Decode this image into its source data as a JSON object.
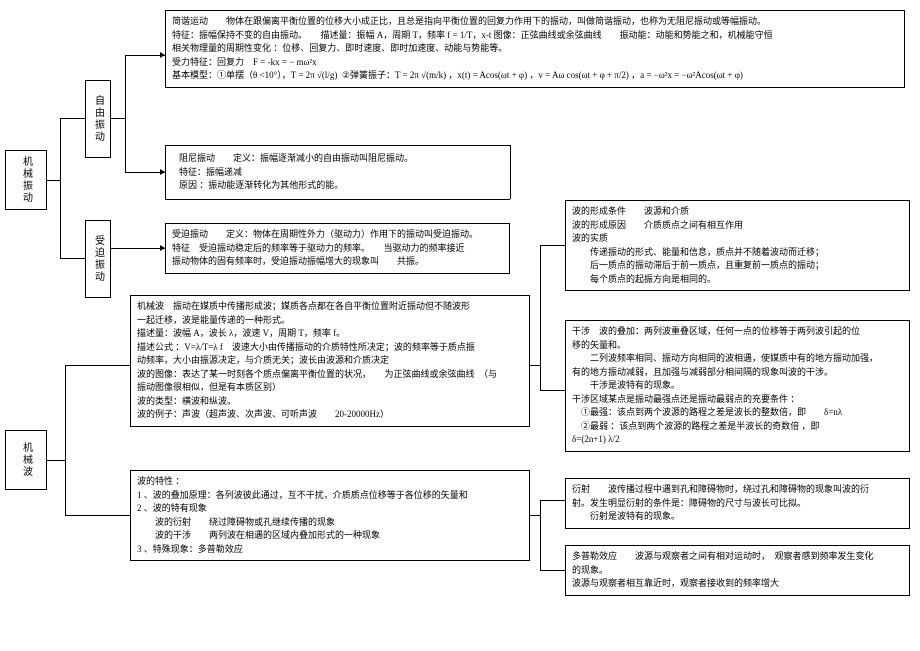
{
  "root1": "机械振动",
  "root2": "机械波",
  "sub1": "自由振动",
  "sub2": "受迫振动",
  "box_shm_title": "简谐运动",
  "box_shm_l1": "简谐运动　　物体在跟偏离平衡位置的位移大小成正比，且总是指向平衡位置的回复力作用下的振动，叫做简谐振动，也称为无阻尼振动或等幅振动。",
  "box_shm_l2": "特征：振幅保持不变的自由振动。　　描述量：振幅 A，周期 T，频率 f = 1/T，x-t 图像：正弦曲线或余弦曲线　　振动能：动能和势能之和，机械能守恒",
  "box_shm_l3": "相关物理量的周期性变化 ：位移、回复力、即时速度、即时加速度、动能与势能等。",
  "box_shm_l4": "受力特征：回复力　F = -kx = − mω²x",
  "box_shm_l5_a": "基本模型：①单摆（θ <10°），T = 2π",
  "box_shm_l5_b": "②弹簧振子：T = 2π",
  "box_shm_l5_c": "，x(t) = Acos(ωt + φ) ，v = Aω cos(ωt + φ + π/2) ，a = −ω²x = −ω²Acos(ωt + φ)",
  "box_damped_l1": "阻尼振动　　定义：振幅逐渐减小的自由振动叫阻尼振动。",
  "box_damped_l2": "特征：振幅递减",
  "box_damped_l3": "原因 ：振动能逐渐转化为其他形式的能。",
  "box_forced_l1": "受迫振动　　定义：物体在周期性外力（驱动力）作用下的振动叫受迫振动。",
  "box_forced_l2": "特征　受迫振动稳定后的频率等于驱动力的频率。　　当驱动力的频率接近",
  "box_forced_l3": "振动物体的固有频率时，受迫振动振幅增大的现象叫　　共振。",
  "box_wave_l1": "机械波　振动在媒质中传播形成波；媒质各点都在各自平衡位置附近振动但不随波形",
  "box_wave_l2": "一起迁移，波是能量传递的一种形式。",
  "box_wave_l3": "描述量：波幅 A，波长 λ，波速 V，周期 T，频率 f。",
  "box_wave_l4": "描述公式 ：V=λ/T=λ f　波速大小由传播振动的介质特性所决定；波的频率等于质点振",
  "box_wave_l5": "动频率，大小由振源决定，与介质无关；波长由波源和介质决定",
  "box_wave_l6": "波的图像：表达了某一时刻各个质点偏离平衡位置的状况，　　为正弦曲线或余弦曲线　（与",
  "box_wave_l7": "振动图像很相似，但是有本质区别）",
  "box_wave_l8": "波的类型：横波和纵波。",
  "box_wave_l9": "波的例子：声波（超声波、次声波、可听声波　　20-20000Hz）",
  "box_props_l1": "波的特性 ：",
  "box_props_l2": "1 、波的叠加原理：各列波彼此通过，互不干扰，介质质点位移等于各位移的矢量和",
  "box_props_l3": "2 、波的特有现象",
  "box_props_l4": "　　波的衍射　　绕过障碍物或孔继续传播的现象",
  "box_props_l5": "　　波的干涉　　两列波在相遇的区域内叠加形式的一种现象",
  "box_props_l6": "3 、特殊现象：多普勒效应",
  "box_form_l1": "波的形成条件　　波源和介质",
  "box_form_l2": "波的形成原因　　介质质点之间有相互作用",
  "box_form_l3": "波的实质",
  "box_form_l4": "　　传递振动的形式、能量和信息，质点并不随着波动而迁移；",
  "box_form_l5": "　　后一质点的振动滞后于前一质点，且重复前一质点的振动；",
  "box_form_l6": "　　每个质点的起振方向是相同的。",
  "box_inter_l1": "干涉　波的叠加：两列波重叠区域，任何一点的位移等于两列波引起的位",
  "box_inter_l2": "移的矢量和。",
  "box_inter_l3": "　　二列波频率相同、振动方向相同的波相遇，使媒质中有的地方振动加强，",
  "box_inter_l4": "有的地方振动减弱，且加强与减弱部分相间隔的现象叫波的干涉。",
  "box_inter_l5": "　　干涉是波特有的现象。",
  "box_inter_l6": "干涉区域某点是振动最强点还是振动最弱点的充要条件 ：",
  "box_inter_l7": "　①最强：该点到两个波源的路程之差是波长的整数倍，即　　δ=nλ",
  "box_inter_l8": "　②最弱 ：该点到两个波源的路程之差是半波长的奇数倍 ，即",
  "box_inter_l9": "δ=(2n+1) λ/2",
  "box_diff_l1": "衍射　　波传播过程中遇到孔和障碍物时，绕过孔和障碍物的现象叫波的衍",
  "box_diff_l2": "射。发生明显衍射的条件是：障碍物的尺寸与波长可比拟。",
  "box_diff_l3": "　　衍射是波特有的现象。",
  "box_dopp_l1": "多普勒效应　　波源与观察者之间有相对运动时，　观察者感到频率发生变化",
  "box_dopp_l2": "的现象。",
  "box_dopp_l3": "波源与观察者相互靠近时，观察者接收到的频率增大"
}
